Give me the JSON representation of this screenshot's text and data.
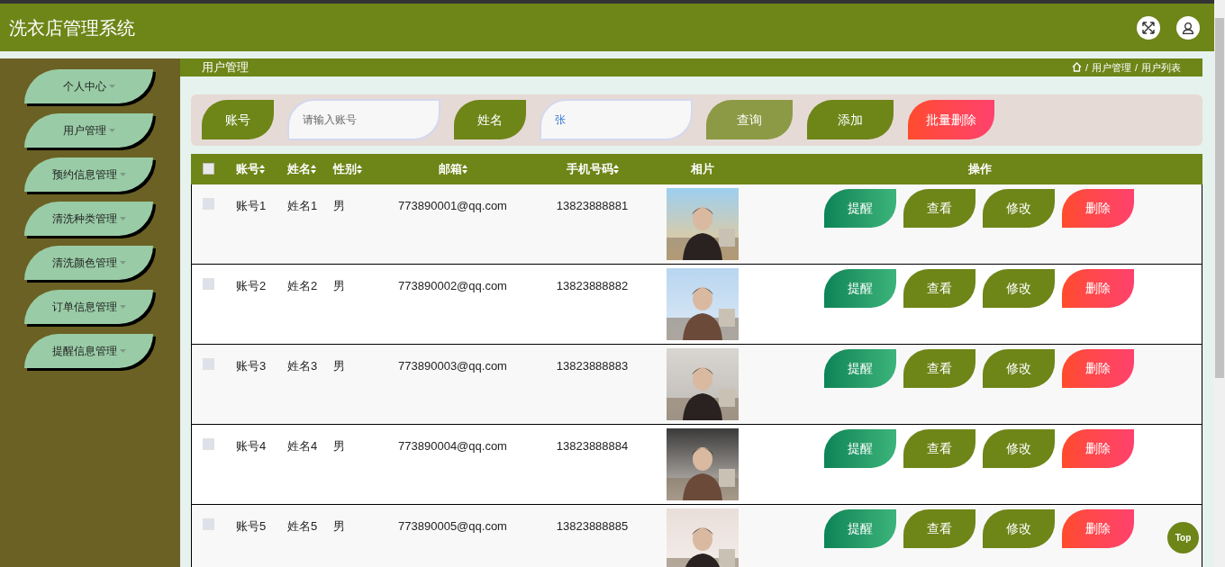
{
  "header": {
    "title": "洗衣店管理系统"
  },
  "sidebar": {
    "items": [
      {
        "label": "个人中心"
      },
      {
        "label": "用户管理"
      },
      {
        "label": "预约信息管理"
      },
      {
        "label": "清洗种类管理"
      },
      {
        "label": "清洗颜色管理"
      },
      {
        "label": "订单信息管理"
      },
      {
        "label": "提醒信息管理"
      }
    ]
  },
  "breadcrumb_bar": {
    "title": "用户管理",
    "path": [
      {
        "separator": "/",
        "label": "用户管理"
      },
      {
        "separator": "/",
        "label": "用户列表"
      }
    ]
  },
  "search": {
    "fields": [
      {
        "label": "账号",
        "placeholder": "请输入账号"
      },
      {
        "label": "姓名",
        "value": "张"
      }
    ],
    "buttons": [
      {
        "kind": "query",
        "label": "查询"
      },
      {
        "kind": "add",
        "label": "添加"
      },
      {
        "kind": "danger",
        "label": "批量删除"
      }
    ]
  },
  "table": {
    "all_checked": false,
    "columns": [
      {
        "label": "账号",
        "sortable": true
      },
      {
        "label": "姓名",
        "sortable": true
      },
      {
        "label": "性别",
        "sortable": true
      },
      {
        "label": "邮箱",
        "sortable": true
      },
      {
        "label": "手机号码",
        "sortable": true
      },
      {
        "label": "相片",
        "sortable": false
      },
      {
        "label": "操作",
        "sortable": false
      }
    ],
    "rows": [
      {
        "checked": false,
        "account": "账号1",
        "name": "姓名1",
        "gender": "男",
        "email": "773890001@qq.com",
        "phone": "13823888881",
        "photo": {
          "kind": "picture"
        },
        "actions": [
          {
            "kind": "remind",
            "label": "提醒"
          },
          {
            "kind": "view",
            "label": "查看"
          },
          {
            "kind": "edit",
            "label": "修改"
          },
          {
            "kind": "danger",
            "label": "删除"
          }
        ]
      },
      {
        "checked": false,
        "account": "账号2",
        "name": "姓名2",
        "gender": "男",
        "email": "773890002@qq.com",
        "phone": "13823888882",
        "photo": {
          "kind": "picture"
        },
        "actions": [
          {
            "kind": "remind",
            "label": "提醒"
          },
          {
            "kind": "view",
            "label": "查看"
          },
          {
            "kind": "edit",
            "label": "修改"
          },
          {
            "kind": "danger",
            "label": "删除"
          }
        ]
      },
      {
        "checked": false,
        "account": "账号3",
        "name": "姓名3",
        "gender": "男",
        "email": "773890003@qq.com",
        "phone": "13823888883",
        "photo": {
          "kind": "picture"
        },
        "actions": [
          {
            "kind": "remind",
            "label": "提醒"
          },
          {
            "kind": "view",
            "label": "查看"
          },
          {
            "kind": "edit",
            "label": "修改"
          },
          {
            "kind": "danger",
            "label": "删除"
          }
        ]
      },
      {
        "checked": false,
        "account": "账号4",
        "name": "姓名4",
        "gender": "男",
        "email": "773890004@qq.com",
        "phone": "13823888884",
        "photo": {
          "kind": "picture"
        },
        "actions": [
          {
            "kind": "remind",
            "label": "提醒"
          },
          {
            "kind": "view",
            "label": "查看"
          },
          {
            "kind": "edit",
            "label": "修改"
          },
          {
            "kind": "danger",
            "label": "删除"
          }
        ]
      },
      {
        "checked": false,
        "account": "账号5",
        "name": "姓名5",
        "gender": "男",
        "email": "773890005@qq.com",
        "phone": "13823888885",
        "photo": {
          "kind": "picture"
        },
        "actions": [
          {
            "kind": "remind",
            "label": "提醒"
          },
          {
            "kind": "view",
            "label": "查看"
          },
          {
            "kind": "edit",
            "label": "修改"
          },
          {
            "kind": "danger",
            "label": "删除"
          }
        ]
      }
    ]
  },
  "back_to_top": {
    "label": "Top"
  }
}
